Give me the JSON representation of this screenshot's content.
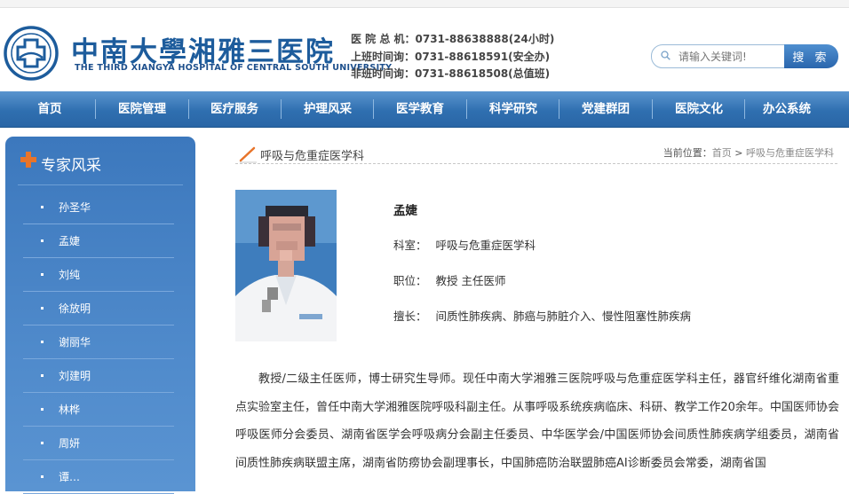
{
  "header": {
    "logo_cn": "中南大學湘雅三医院",
    "logo_en": "THE THIRD XIANGYA HOSPITAL OF CENTRAL SOUTH UNIVERSITY",
    "contacts": [
      "医 院 总 机：0731-88638888(24小时)",
      "上班时间询：0731-88618591(安全办)",
      "非班时间询：0731-88618508(总值班)"
    ],
    "search_placeholder": "请输入关键词!",
    "search_button": "搜 索"
  },
  "nav": [
    "首页",
    "医院管理",
    "医疗服务",
    "护理风采",
    "医学教育",
    "科学研究",
    "党建群团",
    "医院文化",
    "办公系统"
  ],
  "sidebar": {
    "title": "专家风采",
    "items": [
      "孙圣华",
      "孟婕",
      "刘纯",
      "徐放明",
      "谢丽华",
      "刘建明",
      "林桦",
      "周妍",
      "谭…"
    ]
  },
  "main": {
    "section_title": "呼吸与危重症医学科",
    "breadcrumb_label": "当前位置：",
    "breadcrumb_home": "首页",
    "breadcrumb_sep": " > ",
    "breadcrumb_current": "呼吸与危重症医学科",
    "doctor": {
      "name": "孟婕",
      "dept_label": "科室：",
      "dept": "呼吸与危重症医学科",
      "title_label": "职位：",
      "title": "教授 主任医师",
      "specialty_label": "擅长：",
      "specialty": "间质性肺疾病、肺癌与肺脏介入、慢性阻塞性肺疾病"
    },
    "bio": "教授/二级主任医师，博士研究生导师。现任中南大学湘雅三医院呼吸与危重症医学科主任，器官纤维化湖南省重点实验室主任，曾任中南大学湘雅医院呼吸科副主任。从事呼吸系统疾病临床、科研、教学工作20余年。中国医师协会呼吸医师分会委员、湖南省医学会呼吸病分会副主任委员、中华医学会/中国医师协会间质性肺疾病学组委员，湖南省间质性肺疾病联盟主席，湖南省防痨协会副理事长，中国肺癌防治联盟肺癌AI诊断委员会常委，湖南省国"
  },
  "colors": {
    "brand_blue": "#1d5c9c",
    "nav_blue": "#2f6fb0",
    "sidebar_blue": "#4f8acb",
    "accent_orange": "#e8742a"
  }
}
